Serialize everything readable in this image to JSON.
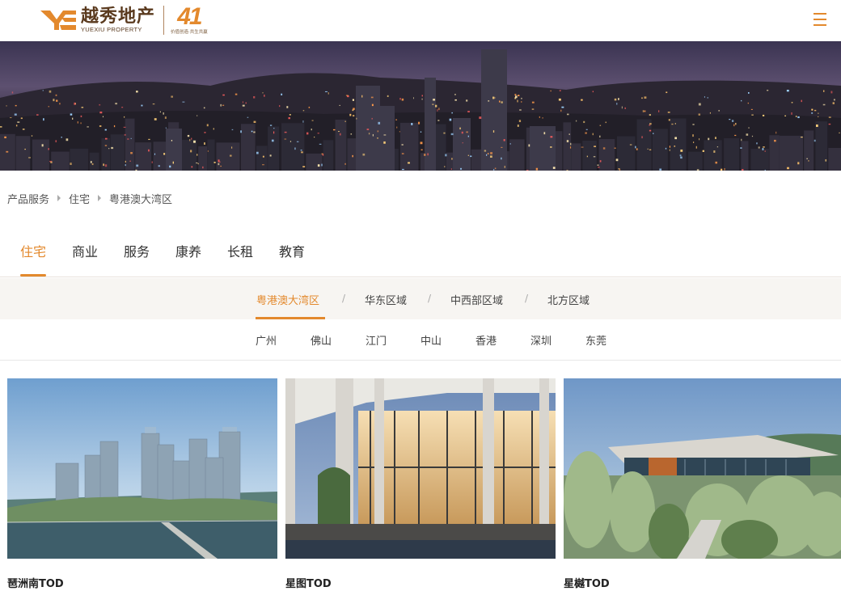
{
  "header": {
    "logo_cn": "越秀地产",
    "logo_en": "YUEXIU PROPERTY",
    "anniversary_num": "41",
    "anniversary_sub": "价值创造·共生共赢"
  },
  "breadcrumb": [
    "产品服务",
    "住宅",
    "粤港澳大湾区"
  ],
  "main_tabs": [
    "住宅",
    "商业",
    "服务",
    "康养",
    "长租",
    "教育"
  ],
  "regions": [
    "粤港澳大湾区",
    "华东区域",
    "中西部区域",
    "北方区域"
  ],
  "region_separator": "/",
  "cities": [
    "广州",
    "佛山",
    "江门",
    "中山",
    "香港",
    "深圳",
    "东莞"
  ],
  "cards": [
    {
      "title": "琶洲南TOD"
    },
    {
      "title": "星图TOD"
    },
    {
      "title": "星樾TOD"
    }
  ],
  "colors": {
    "accent": "#e3892d",
    "brand_brown": "#5a3a1e"
  },
  "icons": [
    "menu-icon",
    "breadcrumb-arrow-icon"
  ]
}
